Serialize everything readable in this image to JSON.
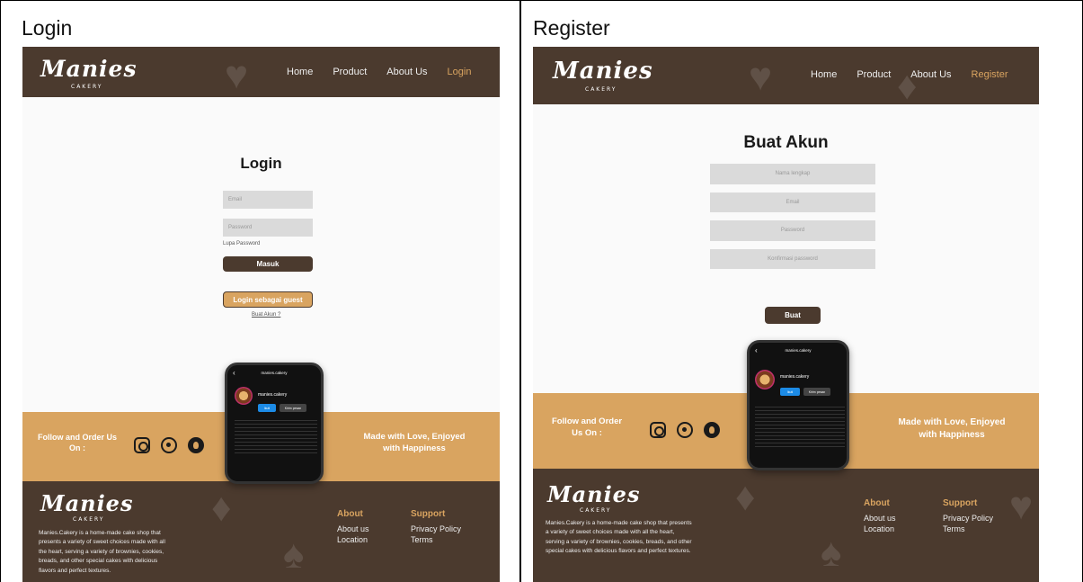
{
  "left_cell": {
    "caption": "Login",
    "brand": {
      "name": "Manies",
      "sub": "CAKERY"
    },
    "nav": [
      "Home",
      "Product",
      "About Us",
      "Login"
    ],
    "form": {
      "title": "Login",
      "email_placeholder": "Email",
      "password_placeholder": "Password",
      "forgot": "Lupa Password",
      "submit": "Masuk",
      "guest": "Login sebagai guest",
      "create_link": "Buat Akun ?"
    },
    "follow": "Follow and Order Us On :",
    "tagline": "Made with Love, Enjoyed with Happiness",
    "phone": {
      "username": "manies.cakery",
      "follow_btn": "Ikuti",
      "message_btn": "Kirim pesan"
    },
    "footer": {
      "description": "Manies.Cakery is a home-made cake shop that presents a variety of sweet choices made with all the heart, serving a variety of brownies, cookies, breads, and other special cakes with delicious flavors and perfect textures.",
      "about_title": "About",
      "about_links": [
        "About us",
        "Location"
      ],
      "support_title": "Support",
      "support_links": [
        "Privacy Policy",
        "Terms"
      ]
    }
  },
  "right_cell": {
    "caption": "Register",
    "brand": {
      "name": "Manies",
      "sub": "CAKERY"
    },
    "nav": [
      "Home",
      "Product",
      "About Us",
      "Register"
    ],
    "form": {
      "title": "Buat Akun",
      "name_placeholder": "Nama lengkap",
      "email_placeholder": "Email",
      "password_placeholder": "Password",
      "confirm_placeholder": "Konfirmasi password",
      "submit": "Buat"
    },
    "follow": "Follow and Order Us On :",
    "tagline": "Made with Love, Enjoyed with Happiness",
    "phone": {
      "username": "manies.cakery",
      "follow_btn": "Ikuti",
      "message_btn": "Kirim pesan"
    },
    "footer": {
      "description": "Manies.Cakery is a home-made cake shop that presents a variety of sweet choices made with all the heart, serving a variety of brownies, cookies, breads, and other special cakes with delicious flavors and perfect textures.",
      "about_title": "About",
      "about_links": [
        "About us",
        "Location"
      ],
      "support_title": "Support",
      "support_links": [
        "Privacy Policy",
        "Terms"
      ]
    }
  },
  "colors": {
    "brown": "#4b3a2e",
    "tan": "#d9a460",
    "field": "#dadada"
  }
}
